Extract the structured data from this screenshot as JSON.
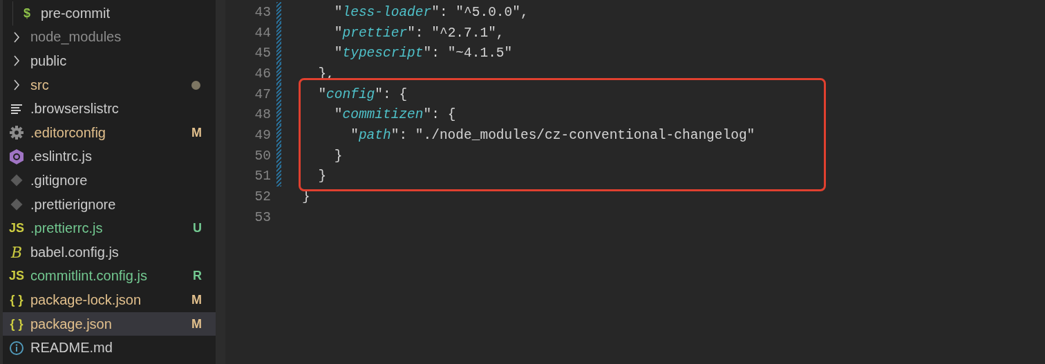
{
  "sidebar": {
    "items": [
      {
        "kind": "group",
        "children": [
          {
            "kind": "shell",
            "icon_text": "$",
            "label": "pre-commit",
            "color": "#cccccc",
            "selected": false
          }
        ]
      },
      {
        "kind": "folder",
        "label": "node_modules",
        "color": "#8c8c8c",
        "selected": false
      },
      {
        "kind": "folder",
        "label": "public",
        "color": "#cccccc",
        "selected": false
      },
      {
        "kind": "folder",
        "label": "src",
        "color": "#e2c08d",
        "badge_dot": true,
        "selected": false
      },
      {
        "kind": "lines",
        "label": ".browserslistrc",
        "color": "#cccccc",
        "selected": false
      },
      {
        "kind": "gear",
        "label": ".editorconfig",
        "color": "#e2c08d",
        "status": "M",
        "selected": false
      },
      {
        "kind": "hexagon",
        "label": ".eslintrc.js",
        "color": "#cccccc",
        "selected": false
      },
      {
        "kind": "diamond",
        "label": ".gitignore",
        "color": "#cccccc",
        "selected": false
      },
      {
        "kind": "diamond",
        "label": ".prettierignore",
        "color": "#cccccc",
        "selected": false
      },
      {
        "kind": "js",
        "icon_text": "JS",
        "label": ".prettierrc.js",
        "color": "#73c991",
        "status": "U",
        "selected": false
      },
      {
        "kind": "babel",
        "icon_text": "B",
        "label": "babel.config.js",
        "color": "#cccccc",
        "selected": false
      },
      {
        "kind": "js",
        "icon_text": "JS",
        "label": "commitlint.config.js",
        "color": "#73c991",
        "status": "R",
        "selected": false
      },
      {
        "kind": "json",
        "icon_text": "{ }",
        "label": "package-lock.json",
        "color": "#e2c08d",
        "status": "M",
        "selected": false
      },
      {
        "kind": "json",
        "icon_text": "{ }",
        "label": "package.json",
        "color": "#e2c08d",
        "status": "M",
        "selected": true
      },
      {
        "kind": "info",
        "label": "README.md",
        "color": "#cccccc",
        "selected": false
      }
    ]
  },
  "editor": {
    "lines": [
      {
        "children": [
          {
            "children": [
              {
                "number": "43",
                "changed": true,
                "tokens": [
                  {
                    "kind": "punct",
                    "text": "\""
                  },
                  {
                    "kind": "key",
                    "text": "less-loader"
                  },
                  {
                    "kind": "punct",
                    "text": "\": "
                  },
                  {
                    "kind": "string",
                    "text": "\"^5.0.0\""
                  },
                  {
                    "kind": "punct",
                    "text": ","
                  }
                ]
              },
              {
                "number": "44",
                "changed": true,
                "tokens": [
                  {
                    "kind": "punct",
                    "text": "\""
                  },
                  {
                    "kind": "key",
                    "text": "prettier"
                  },
                  {
                    "kind": "punct",
                    "text": "\": "
                  },
                  {
                    "kind": "string",
                    "text": "\"^2.7.1\""
                  },
                  {
                    "kind": "punct",
                    "text": ","
                  }
                ]
              },
              {
                "number": "45",
                "changed": true,
                "tokens": [
                  {
                    "kind": "punct",
                    "text": "\""
                  },
                  {
                    "kind": "key",
                    "text": "typescript"
                  },
                  {
                    "kind": "punct",
                    "text": "\": "
                  },
                  {
                    "kind": "string",
                    "text": "\"~4.1.5\""
                  }
                ]
              }
            ]
          },
          {
            "number": "46",
            "changed": true,
            "tokens": [
              {
                "kind": "punct",
                "text": "},"
              }
            ]
          },
          {
            "number": "47",
            "changed": true,
            "tokens": [
              {
                "kind": "punct",
                "text": "\""
              },
              {
                "kind": "key",
                "text": "config"
              },
              {
                "kind": "punct",
                "text": "\": {"
              }
            ],
            "children": [
              {
                "number": "48",
                "changed": true,
                "tokens": [
                  {
                    "kind": "punct",
                    "text": "\""
                  },
                  {
                    "kind": "key",
                    "text": "commitizen"
                  },
                  {
                    "kind": "punct",
                    "text": "\": {"
                  }
                ],
                "children": [
                  {
                    "number": "49",
                    "changed": true,
                    "tokens": [
                      {
                        "kind": "punct",
                        "text": "\""
                      },
                      {
                        "kind": "key",
                        "text": "path"
                      },
                      {
                        "kind": "punct",
                        "text": "\": "
                      },
                      {
                        "kind": "string",
                        "text": "\"./node_modules/cz-conventional-changelog\""
                      }
                    ]
                  }
                ]
              },
              {
                "number": "50",
                "changed": true,
                "tokens": [
                  {
                    "kind": "punct",
                    "text": "}"
                  }
                ]
              }
            ]
          },
          {
            "number": "51",
            "changed": true,
            "tokens": [
              {
                "kind": "punct",
                "text": "}"
              }
            ]
          }
        ]
      },
      {
        "number": "52",
        "changed": false,
        "tokens": [
          {
            "kind": "punct",
            "text": "}"
          }
        ]
      },
      {
        "number": "53",
        "changed": false
      }
    ]
  }
}
